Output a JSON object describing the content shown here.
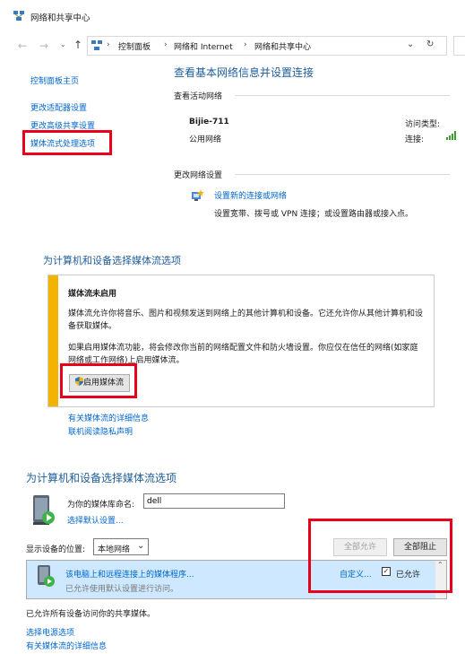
{
  "window": {
    "title": "网络和共享中心"
  },
  "address": {
    "segments": [
      "控制面板",
      "网络和 Internet",
      "网络和共享中心"
    ]
  },
  "sidebar": {
    "items": [
      {
        "label": "控制面板主页"
      },
      {
        "label": "更改适配器设置"
      },
      {
        "label": "更改高级共享设置"
      },
      {
        "label": "媒体流式处理选项"
      }
    ]
  },
  "main": {
    "title": "查看基本网络信息并设置连接",
    "active_networks_label": "查看活动网络",
    "network_name": "Bijie-711",
    "network_type": "公用网络",
    "access_type_label": "访问类型:",
    "connection_label": "连接:",
    "change_settings_label": "更改网络设置",
    "new_connection_link": "设置新的连接或网络",
    "new_connection_desc": "设置宽带、拨号或 VPN 连接；或设置路由器或接入点。"
  },
  "media_panel": {
    "title": "为计算机和设备选择媒体流选项",
    "box_title": "媒体流未启用",
    "para1": "媒体流允许你将音乐、图片和视频发送到网络上的其他计算机和设备。它还允许你从其他计算机和设备获取媒体。",
    "para2": "如果启用媒体流功能，将会修改你当前的网络配置文件和防火墙设置。你应仅在信任的网络(如家庭网络或工作网络)上启用媒体流。",
    "enable_button": "启用媒体流",
    "more_info_link": "有关媒体流的详细信息",
    "privacy_link": "联机阅读隐私声明"
  },
  "media_options": {
    "title": "为计算机和设备选择媒体流选项",
    "library_name_label": "为你的媒体库命名:",
    "library_name_value": "dell",
    "choose_defaults_link": "选择默认设置...",
    "show_devices_label": "显示设备的位置:",
    "show_devices_value": "本地网络",
    "allow_all_button": "全部允许",
    "block_all_button": "全部阻止",
    "device_name": "该电脑上和远程连接上的媒体程序...",
    "device_status": "已允许使用默认设置进行访问。",
    "customize_link": "自定义...",
    "allowed_label": "已允许",
    "all_allowed_text": "已允许所有设备访问你的共享媒体。",
    "power_options_link": "选择电源选项",
    "more_info_link": "有关媒体流的详细信息"
  },
  "colors": {
    "accent_blue": "#1e5d9a",
    "link_blue": "#0066cc",
    "highlight_red": "#e8001b",
    "warning_bar": "#f2b400"
  }
}
